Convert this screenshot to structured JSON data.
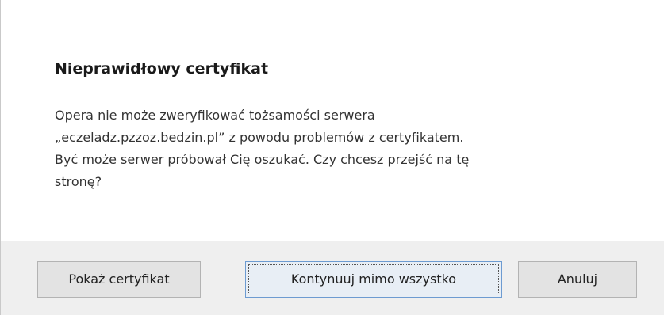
{
  "dialog": {
    "title": "Nieprawidłowy certyfikat",
    "message_lines": [
      "Opera nie może zweryfikować tożsamości serwera",
      "„eczeladz.pzzoz.bedzin.pl” z powodu problemów z certyfikatem.",
      "Być może serwer próbował Cię oszukać. Czy chcesz przejść na tę",
      "stronę?"
    ]
  },
  "buttons": {
    "show_certificate": "Pokaż certyfikat",
    "continue": "Kontynuuj mimo wszystko",
    "cancel": "Anuluj"
  }
}
